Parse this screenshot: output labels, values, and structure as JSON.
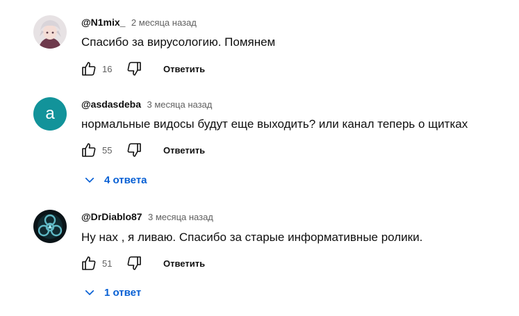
{
  "comments": [
    {
      "author": "@N1mix_",
      "time": "2 месяца назад",
      "text": "Спасибо за вирусологию. Помянем",
      "likes": "16",
      "reply_label": "Ответить",
      "avatar": "anime-character-avatar"
    },
    {
      "author": "@asdasdeba",
      "time": "3 месяца назад",
      "text": "нормальные видосы будут еще выходить? или канал теперь о щитках",
      "likes": "55",
      "reply_label": "Ответить",
      "avatar_letter": "a",
      "avatar_color": "#12939a",
      "replies_label": "4 ответа"
    },
    {
      "author": "@DrDiablo87",
      "time": "3 месяца назад",
      "text": "Ну нах , я ливаю. Спасибо за старые информативные ролики.",
      "likes": "51",
      "reply_label": "Ответить",
      "avatar": "biohazard-avatar",
      "replies_label": "1 ответ"
    }
  ],
  "icons": [
    "like-icon",
    "dislike-icon",
    "chevron-down-icon"
  ],
  "colors": {
    "link": "#065fd4",
    "secondary_text": "#606060",
    "primary_text": "#0f0f0f"
  }
}
